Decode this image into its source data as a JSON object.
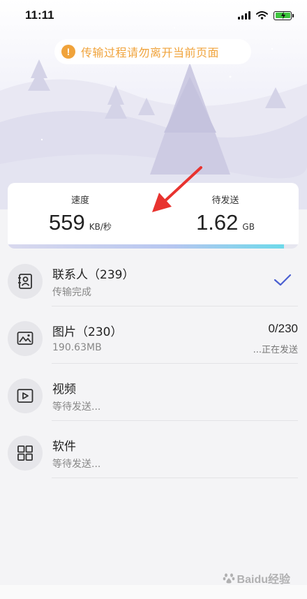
{
  "status_bar": {
    "time": "11:11"
  },
  "notice": {
    "icon": "warning-icon",
    "text": "传输过程请勿离开当前页面",
    "color": "#f0a33b"
  },
  "stats": {
    "speed": {
      "label": "速度",
      "value": "559",
      "unit": "KB/秒"
    },
    "pending": {
      "label": "待发送",
      "value": "1.62",
      "unit": "GB"
    },
    "progress_fraction": 0.95
  },
  "items": [
    {
      "icon": "contacts-icon",
      "title": "联系人（239）",
      "subtitle": "传输完成",
      "status": "complete"
    },
    {
      "icon": "image-icon",
      "title": "图片（230）",
      "subtitle": "190.63MB",
      "count": "0/230",
      "state": "...正在发送"
    },
    {
      "icon": "video-icon",
      "title": "视频",
      "subtitle": "等待发送..."
    },
    {
      "icon": "apps-icon",
      "title": "软件",
      "subtitle": "等待发送..."
    }
  ],
  "watermark": {
    "text": "Baidu经验"
  },
  "colors": {
    "accent": "#4a5fd1",
    "annotation_arrow": "#e8332f"
  }
}
